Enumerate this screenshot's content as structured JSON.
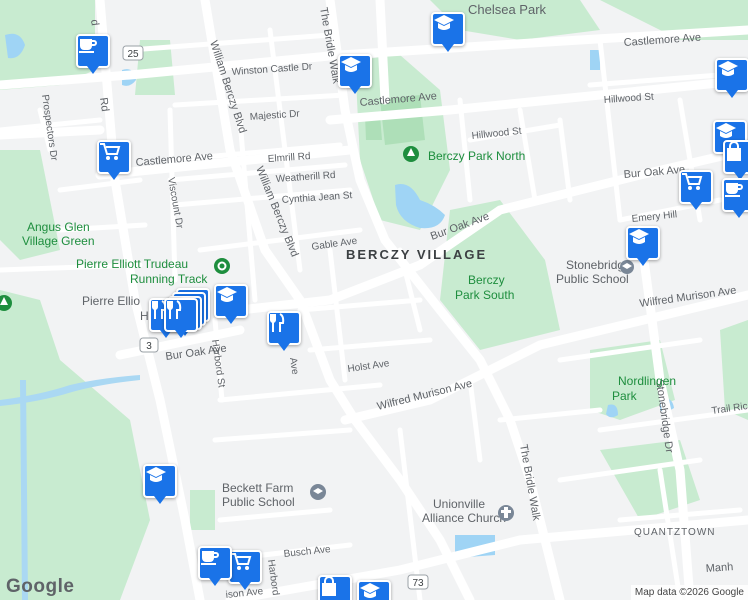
{
  "map": {
    "area_label": "BERCZY VILLAGE",
    "area_label_small": "QUANTZTOWN",
    "streets": {
      "chelsea_park": "Chelsea Park",
      "castlemore_ave_ne": "Castlemore Ave",
      "castlemore_ave_mid": "Castlemore Ave",
      "castlemore_ave_w": "Castlemore Ave",
      "winston_castle": "Winston Castle Dr",
      "majestic": "Majestic Dr",
      "elmrill": "Elmrill Rd",
      "weatherill": "Weatherill Rd",
      "cynthia_jean": "Cynthia Jean St",
      "gable": "Gable Ave",
      "bridle_walk_n": "The Bridle Walk",
      "bridle_walk_s": "The Bridle Walk",
      "william_berczy_1": "William Berczy Blvd",
      "william_berczy_2": "William Berczy Blvd",
      "hillwood_1": "Hillwood St",
      "hillwood_2": "Hillwood St",
      "bur_oak_ne": "Bur Oak Ave",
      "bur_oak_mid": "Bur Oak Ave",
      "bur_oak_w": "Bur Oak Ave",
      "emery_hill": "Emery Hill",
      "wilfred_murison_e": "Wilfred Murison Ave",
      "wilfred_murison_mid": "Wilfred Murison Ave",
      "holst": "Holst Ave",
      "viscount": "Viscount Dr",
      "harbord_1": "Harbord St",
      "harbord_2": "Harbord",
      "ave_fragment": "Ave",
      "prospectors": "Prospectors Dr",
      "busch": "Busch Ave",
      "stonebridge": "Stonebridge Dr",
      "trail_ridge": "Trail Ric",
      "manh": "Manh",
      "rd_fragment": "Rd",
      "ison_ave": "ison Ave",
      "rd_left": "d"
    },
    "places": {
      "berczy_park_north": "Berczy Park North",
      "berczy_park_south_1": "Berczy",
      "berczy_park_south_2": "Park South",
      "angus_glen_1": "Angus Glen",
      "angus_glen_2": "Village Green",
      "pierre_trudeau_track_1": "Pierre Elliott Trudeau",
      "pierre_trudeau_track_2": "Running Track",
      "pierre_elliott_hs_1": "Pierre Ellio",
      "pierre_elliott_hs_2": "Hi",
      "stonebridge_ps_1": "Stonebridge",
      "stonebridge_ps_2": "Public School",
      "nordlingen_1": "Nordlingen",
      "nordlingen_2": "Park",
      "beckett_farm_1": "Beckett Farm",
      "beckett_farm_2": "Public School",
      "unionville_alliance_1": "Unionville",
      "unionville_alliance_2": "Alliance Church"
    },
    "shields": {
      "r25": "25",
      "r3": "3",
      "r73": "73"
    },
    "footer": {
      "logo": "Google",
      "attribution": "Map data ©2026 Google"
    },
    "markers": [
      {
        "icon": "cafe-icon"
      },
      {
        "icon": "school-icon"
      },
      {
        "icon": "school-icon"
      },
      {
        "icon": "school-icon"
      },
      {
        "icon": "school-icon"
      },
      {
        "icon": "school-icon"
      },
      {
        "icon": "school-icon"
      },
      {
        "icon": "school-icon"
      },
      {
        "icon": "shopping-cart-icon"
      },
      {
        "icon": "shopping-cart-icon"
      },
      {
        "icon": "shopping-cart-icon"
      },
      {
        "icon": "shopping-bag-icon"
      },
      {
        "icon": "shopping-bag-icon"
      },
      {
        "icon": "restaurant-icon"
      },
      {
        "icon": "restaurant-icon"
      },
      {
        "icon": "cafe-icon"
      },
      {
        "icon": "cafe-icon"
      }
    ],
    "colors": {
      "water": "#9fd4f5",
      "park": "#c8ebd0",
      "road": "#ffffff",
      "marker": "#1a73e8"
    }
  }
}
